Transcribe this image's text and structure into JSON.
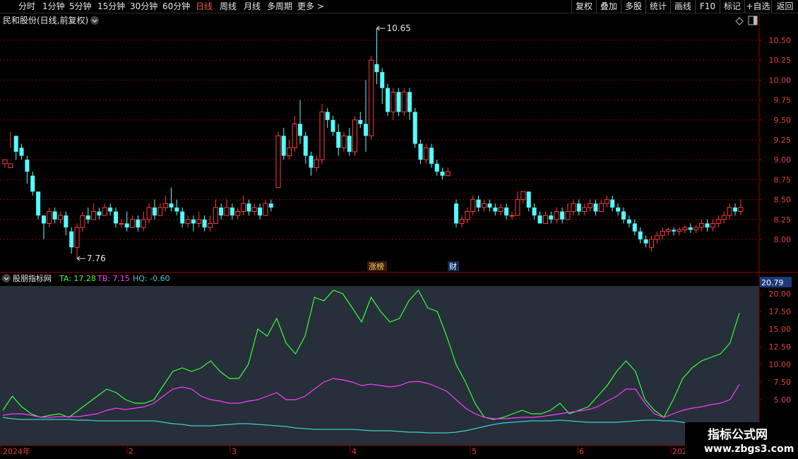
{
  "toolbar": {
    "periods": [
      "分时",
      "1分钟",
      "5分钟",
      "15分钟",
      "30分钟",
      "60分钟",
      "日线",
      "周线",
      "月线",
      "多周期",
      "更多 >"
    ],
    "active_period": "日线",
    "right_buttons": [
      "复权",
      "叠加",
      "多股",
      "统计",
      "画线",
      "F10",
      "标记",
      "+自选",
      "返回"
    ]
  },
  "main_chart": {
    "title": "民和股份(日线,前复权)",
    "high_label": "10.65",
    "low_label": "7.76",
    "event_tags": [
      "涨榜",
      "财"
    ],
    "price_axis": [
      "10.50",
      "10.25",
      "10.00",
      "9.75",
      "9.50",
      "9.25",
      "9.00",
      "8.75",
      "8.50",
      "8.25",
      "8.00"
    ]
  },
  "indicator": {
    "name": "股朋指标网",
    "ta_label": "TA: 17.28",
    "tb_label": "TB: 7.15",
    "hq_label": "HQ: -0.60",
    "max_label": "20.79",
    "axis": [
      "20.00",
      "17.50",
      "15.00",
      "12.50",
      "10.00",
      "7.50",
      "5.00"
    ]
  },
  "date_axis": [
    "2024年",
    "2",
    "3",
    "4",
    "5",
    "6",
    "202"
  ],
  "watermark": {
    "title": "指标公式网",
    "url": "www.zbgs3.com"
  },
  "colors": {
    "up": "#ff3b3b",
    "down": "#54ffff",
    "ta": "#39ff39",
    "tb": "#ff3bff",
    "hq": "#3bd0d0",
    "grid": "#8b0000",
    "panel_bg": "#262f3a"
  },
  "chart_data": [
    {
      "type": "candlestick",
      "title": "民和股份(日线,前复权)",
      "ylim": [
        7.75,
        10.75
      ],
      "high": 10.65,
      "low": 7.76,
      "candles": [
        [
          8.95,
          9.0,
          8.9,
          8.95
        ],
        [
          8.9,
          8.95,
          9.15,
          9.35
        ],
        [
          9.3,
          9.1,
          9.0,
          9.3
        ],
        [
          9.15,
          9.05,
          9.0,
          9.2
        ],
        [
          9.0,
          8.85,
          8.7,
          9.05
        ],
        [
          8.8,
          8.6,
          8.55,
          8.85
        ],
        [
          8.6,
          8.3,
          8.25,
          8.6
        ],
        [
          8.3,
          8.2,
          8.0,
          8.3
        ],
        [
          8.2,
          8.35,
          8.15,
          8.4
        ],
        [
          8.35,
          8.25,
          8.2,
          8.4
        ],
        [
          8.25,
          8.3,
          8.2,
          8.35
        ],
        [
          8.3,
          8.15,
          8.05,
          8.35
        ],
        [
          8.1,
          7.9,
          7.82,
          8.15
        ],
        [
          7.9,
          8.15,
          7.76,
          8.2
        ],
        [
          8.15,
          8.3,
          8.1,
          8.35
        ],
        [
          8.3,
          8.25,
          8.2,
          8.4
        ],
        [
          8.25,
          8.35,
          8.25,
          8.45
        ],
        [
          8.35,
          8.3,
          8.25,
          8.4
        ],
        [
          8.3,
          8.4,
          8.3,
          8.45
        ],
        [
          8.4,
          8.35,
          8.3,
          8.45
        ],
        [
          8.35,
          8.2,
          8.15,
          8.4
        ],
        [
          8.2,
          8.2,
          8.15,
          8.25
        ],
        [
          8.2,
          8.15,
          8.1,
          8.35
        ],
        [
          8.15,
          8.25,
          8.15,
          8.3
        ],
        [
          8.25,
          8.15,
          8.1,
          8.3
        ],
        [
          8.15,
          8.25,
          8.1,
          8.35
        ],
        [
          8.25,
          8.4,
          8.2,
          8.45
        ],
        [
          8.4,
          8.3,
          8.25,
          8.5
        ],
        [
          8.3,
          8.4,
          8.3,
          8.45
        ],
        [
          8.4,
          8.45,
          8.35,
          8.55
        ],
        [
          8.45,
          8.4,
          8.35,
          8.65
        ],
        [
          8.4,
          8.35,
          8.3,
          8.5
        ],
        [
          8.35,
          8.2,
          8.15,
          8.4
        ],
        [
          8.2,
          8.25,
          8.15,
          8.3
        ],
        [
          8.25,
          8.2,
          8.1,
          8.3
        ],
        [
          8.2,
          8.25,
          8.15,
          8.35
        ],
        [
          8.25,
          8.15,
          8.1,
          8.3
        ],
        [
          8.15,
          8.2,
          8.1,
          8.3
        ],
        [
          8.2,
          8.4,
          8.2,
          8.5
        ],
        [
          8.4,
          8.3,
          8.25,
          8.45
        ],
        [
          8.3,
          8.4,
          8.3,
          8.5
        ],
        [
          8.4,
          8.3,
          8.25,
          8.45
        ],
        [
          8.3,
          8.35,
          8.25,
          8.4
        ],
        [
          8.35,
          8.45,
          8.3,
          8.55
        ],
        [
          8.45,
          8.35,
          8.3,
          8.5
        ],
        [
          8.35,
          8.4,
          8.3,
          8.45
        ],
        [
          8.4,
          8.3,
          8.25,
          8.45
        ],
        [
          8.3,
          8.45,
          8.3,
          8.5
        ],
        [
          8.45,
          8.4,
          8.35,
          8.5
        ],
        [
          8.65,
          9.3,
          8.65,
          9.35
        ],
        [
          9.3,
          9.05,
          9.0,
          9.4
        ],
        [
          9.05,
          9.15,
          9.0,
          9.25
        ],
        [
          9.15,
          9.45,
          9.1,
          9.55
        ],
        [
          9.45,
          9.3,
          9.2,
          9.75
        ],
        [
          9.3,
          9.05,
          8.95,
          9.35
        ],
        [
          9.05,
          8.9,
          8.8,
          9.1
        ],
        [
          8.9,
          9.0,
          8.85,
          9.05
        ],
        [
          9.0,
          9.6,
          8.95,
          9.7
        ],
        [
          9.6,
          9.5,
          9.4,
          9.65
        ],
        [
          9.5,
          9.35,
          9.3,
          9.55
        ],
        [
          9.35,
          9.15,
          9.05,
          9.45
        ],
        [
          9.15,
          9.3,
          9.1,
          9.35
        ],
        [
          9.3,
          9.1,
          9.05,
          9.4
        ],
        [
          9.1,
          9.5,
          9.05,
          9.55
        ],
        [
          9.5,
          9.45,
          9.4,
          9.6
        ],
        [
          9.45,
          9.3,
          9.1,
          10.0
        ],
        [
          9.3,
          10.25,
          9.25,
          10.3
        ],
        [
          10.2,
          10.1,
          9.95,
          10.65
        ],
        [
          10.1,
          9.9,
          9.7,
          10.15
        ],
        [
          9.9,
          9.6,
          9.55,
          9.95
        ],
        [
          9.6,
          9.85,
          9.5,
          9.9
        ],
        [
          9.85,
          9.6,
          9.55,
          9.9
        ],
        [
          9.6,
          9.85,
          9.55,
          9.9
        ],
        [
          9.85,
          9.6,
          9.5,
          9.9
        ],
        [
          9.6,
          9.2,
          9.15,
          9.65
        ],
        [
          9.2,
          9.0,
          8.95,
          9.25
        ],
        [
          9.0,
          9.15,
          8.95,
          9.2
        ],
        [
          9.15,
          8.95,
          8.9,
          9.2
        ],
        [
          8.95,
          8.85,
          8.8,
          9.0
        ],
        [
          8.85,
          8.8,
          8.75,
          8.9
        ],
        [
          8.8,
          8.85,
          8.8,
          8.9
        ],
        [
          8.45,
          8.2,
          8.15,
          8.5
        ],
        [
          8.2,
          8.25,
          8.15,
          8.3
        ],
        [
          8.25,
          8.35,
          8.2,
          8.4
        ],
        [
          8.35,
          8.5,
          8.3,
          8.55
        ],
        [
          8.5,
          8.4,
          8.35,
          8.55
        ],
        [
          8.4,
          8.45,
          8.35,
          8.5
        ],
        [
          8.45,
          8.4,
          8.35,
          8.5
        ],
        [
          8.4,
          8.35,
          8.3,
          8.45
        ],
        [
          8.35,
          8.4,
          8.3,
          8.45
        ],
        [
          8.4,
          8.3,
          8.25,
          8.45
        ],
        [
          8.3,
          8.3,
          8.25,
          8.35
        ],
        [
          8.3,
          8.5,
          8.3,
          8.6
        ],
        [
          8.5,
          8.6,
          8.45,
          8.6
        ],
        [
          8.6,
          8.4,
          8.35,
          8.6
        ],
        [
          8.4,
          8.3,
          8.25,
          8.45
        ],
        [
          8.3,
          8.2,
          8.2,
          8.35
        ],
        [
          8.2,
          8.3,
          8.2,
          8.35
        ],
        [
          8.3,
          8.25,
          8.2,
          8.35
        ],
        [
          8.25,
          8.35,
          8.2,
          8.4
        ],
        [
          8.35,
          8.25,
          8.2,
          8.4
        ],
        [
          8.25,
          8.35,
          8.25,
          8.45
        ],
        [
          8.35,
          8.45,
          8.3,
          8.5
        ],
        [
          8.45,
          8.35,
          8.3,
          8.5
        ],
        [
          8.35,
          8.4,
          8.3,
          8.45
        ],
        [
          8.4,
          8.45,
          8.35,
          8.5
        ],
        [
          8.45,
          8.35,
          8.3,
          8.5
        ],
        [
          8.35,
          8.45,
          8.35,
          8.5
        ],
        [
          8.45,
          8.5,
          8.4,
          8.55
        ],
        [
          8.5,
          8.4,
          8.35,
          8.55
        ],
        [
          8.4,
          8.35,
          8.3,
          8.45
        ],
        [
          8.35,
          8.25,
          8.2,
          8.4
        ],
        [
          8.25,
          8.2,
          8.15,
          8.3
        ],
        [
          8.2,
          8.1,
          8.05,
          8.25
        ],
        [
          8.1,
          8.0,
          7.95,
          8.15
        ],
        [
          8.0,
          7.95,
          7.9,
          8.05
        ],
        [
          7.9,
          8.0,
          7.85,
          8.05
        ],
        [
          8.0,
          8.05,
          7.95,
          8.1
        ],
        [
          8.05,
          8.1,
          8.0,
          8.15
        ],
        [
          8.1,
          8.12,
          8.05,
          8.15
        ],
        [
          8.12,
          8.1,
          8.05,
          8.15
        ],
        [
          8.1,
          8.12,
          8.05,
          8.15
        ],
        [
          8.12,
          8.15,
          8.08,
          8.18
        ],
        [
          8.15,
          8.12,
          8.08,
          8.2
        ],
        [
          8.12,
          8.15,
          8.08,
          8.18
        ],
        [
          8.15,
          8.2,
          8.1,
          8.25
        ],
        [
          8.2,
          8.15,
          8.1,
          8.25
        ],
        [
          8.15,
          8.2,
          8.1,
          8.25
        ],
        [
          8.2,
          8.25,
          8.15,
          8.3
        ],
        [
          8.25,
          8.3,
          8.2,
          8.35
        ],
        [
          8.3,
          8.4,
          8.25,
          8.45
        ],
        [
          8.4,
          8.35,
          8.3,
          8.45
        ],
        [
          8.35,
          8.4,
          8.3,
          8.5
        ]
      ]
    },
    {
      "type": "line",
      "title": "股朋指标网",
      "ylim": [
        0,
        21
      ],
      "series": [
        {
          "name": "TA",
          "values": [
            3.5,
            5.5,
            4.0,
            3.0,
            2.5,
            2.8,
            3.0,
            2.5,
            3.5,
            4.5,
            5.5,
            6.5,
            6.0,
            5.0,
            4.5,
            4.5,
            5.0,
            7.0,
            9.0,
            9.5,
            9.0,
            9.5,
            10.5,
            9.0,
            8.0,
            8.0,
            10.0,
            15.0,
            14.0,
            16.5,
            13.0,
            11.5,
            14.0,
            19.5,
            19.0,
            20.5,
            20.0,
            18.0,
            16.0,
            19.5,
            17.5,
            16.0,
            16.5,
            19.0,
            20.5,
            18.0,
            17.5,
            14.0,
            10.0,
            7.5,
            4.5,
            2.5,
            2.2,
            2.5,
            3.0,
            3.5,
            3.0,
            3.0,
            3.5,
            4.5,
            3.0,
            3.5,
            4.0,
            5.5,
            7.0,
            9.0,
            10.5,
            9.0,
            5.0,
            3.5,
            2.5,
            5.0,
            8.0,
            9.5,
            10.5,
            11.0,
            11.5,
            13.0,
            17.28
          ]
        },
        {
          "name": "TB",
          "values": [
            2.8,
            3.0,
            3.0,
            2.8,
            2.5,
            2.5,
            2.6,
            2.6,
            2.6,
            2.8,
            3.0,
            3.5,
            3.8,
            3.6,
            3.8,
            4.0,
            4.5,
            5.5,
            6.5,
            6.8,
            6.5,
            5.5,
            5.0,
            4.8,
            4.5,
            4.5,
            4.8,
            5.0,
            5.5,
            6.0,
            5.0,
            5.0,
            5.5,
            6.5,
            7.5,
            8.0,
            7.8,
            7.5,
            7.0,
            7.2,
            7.0,
            6.8,
            7.0,
            7.5,
            7.6,
            7.3,
            6.8,
            6.2,
            5.0,
            3.8,
            3.0,
            2.5,
            2.3,
            2.3,
            2.4,
            2.5,
            2.5,
            2.6,
            2.8,
            3.0,
            3.2,
            3.4,
            3.6,
            4.0,
            4.8,
            5.5,
            6.5,
            6.5,
            4.5,
            3.0,
            2.5,
            3.0,
            3.5,
            3.8,
            4.0,
            4.3,
            4.5,
            5.0,
            7.15
          ]
        },
        {
          "name": "HQ",
          "values": [
            2.5,
            2.3,
            2.2,
            2.2,
            2.2,
            2.2,
            2.2,
            2.2,
            2.1,
            2.1,
            2.0,
            2.0,
            2.0,
            2.0,
            2.0,
            2.0,
            2.0,
            1.8,
            1.6,
            1.5,
            1.3,
            1.3,
            1.3,
            1.4,
            1.5,
            1.6,
            1.6,
            1.5,
            1.4,
            1.3,
            1.2,
            1.0,
            0.9,
            0.8,
            0.8,
            0.8,
            0.8,
            0.8,
            0.7,
            0.6,
            0.6,
            0.6,
            0.5,
            0.4,
            0.4,
            0.3,
            0.3,
            0.3,
            0.4,
            0.6,
            0.9,
            1.2,
            1.5,
            1.7,
            1.8,
            1.9,
            2.0,
            2.0,
            2.0,
            2.1,
            2.0,
            1.9,
            1.8,
            1.8,
            1.8,
            1.8,
            1.9,
            2.0,
            2.1,
            2.1,
            2.0,
            2.0,
            1.8,
            1.6,
            1.4,
            1.2,
            1.0,
            0.8,
            -0.6
          ]
        }
      ]
    }
  ]
}
